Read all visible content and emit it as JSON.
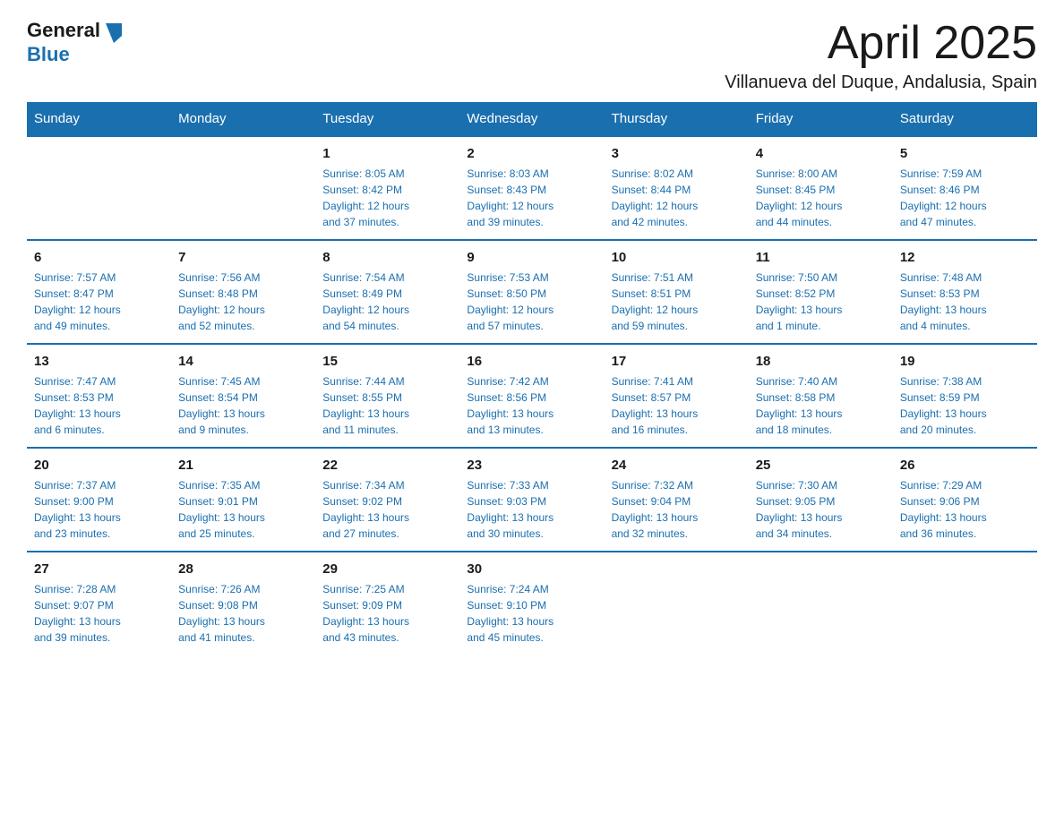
{
  "header": {
    "logo": {
      "general": "General",
      "blue": "Blue",
      "arrow_color": "#1a6faf"
    },
    "title": "April 2025",
    "subtitle": "Villanueva del Duque, Andalusia, Spain"
  },
  "calendar": {
    "days_of_week": [
      "Sunday",
      "Monday",
      "Tuesday",
      "Wednesday",
      "Thursday",
      "Friday",
      "Saturday"
    ],
    "weeks": [
      [
        {
          "day": "",
          "info": ""
        },
        {
          "day": "",
          "info": ""
        },
        {
          "day": "1",
          "info": "Sunrise: 8:05 AM\nSunset: 8:42 PM\nDaylight: 12 hours\nand 37 minutes."
        },
        {
          "day": "2",
          "info": "Sunrise: 8:03 AM\nSunset: 8:43 PM\nDaylight: 12 hours\nand 39 minutes."
        },
        {
          "day": "3",
          "info": "Sunrise: 8:02 AM\nSunset: 8:44 PM\nDaylight: 12 hours\nand 42 minutes."
        },
        {
          "day": "4",
          "info": "Sunrise: 8:00 AM\nSunset: 8:45 PM\nDaylight: 12 hours\nand 44 minutes."
        },
        {
          "day": "5",
          "info": "Sunrise: 7:59 AM\nSunset: 8:46 PM\nDaylight: 12 hours\nand 47 minutes."
        }
      ],
      [
        {
          "day": "6",
          "info": "Sunrise: 7:57 AM\nSunset: 8:47 PM\nDaylight: 12 hours\nand 49 minutes."
        },
        {
          "day": "7",
          "info": "Sunrise: 7:56 AM\nSunset: 8:48 PM\nDaylight: 12 hours\nand 52 minutes."
        },
        {
          "day": "8",
          "info": "Sunrise: 7:54 AM\nSunset: 8:49 PM\nDaylight: 12 hours\nand 54 minutes."
        },
        {
          "day": "9",
          "info": "Sunrise: 7:53 AM\nSunset: 8:50 PM\nDaylight: 12 hours\nand 57 minutes."
        },
        {
          "day": "10",
          "info": "Sunrise: 7:51 AM\nSunset: 8:51 PM\nDaylight: 12 hours\nand 59 minutes."
        },
        {
          "day": "11",
          "info": "Sunrise: 7:50 AM\nSunset: 8:52 PM\nDaylight: 13 hours\nand 1 minute."
        },
        {
          "day": "12",
          "info": "Sunrise: 7:48 AM\nSunset: 8:53 PM\nDaylight: 13 hours\nand 4 minutes."
        }
      ],
      [
        {
          "day": "13",
          "info": "Sunrise: 7:47 AM\nSunset: 8:53 PM\nDaylight: 13 hours\nand 6 minutes."
        },
        {
          "day": "14",
          "info": "Sunrise: 7:45 AM\nSunset: 8:54 PM\nDaylight: 13 hours\nand 9 minutes."
        },
        {
          "day": "15",
          "info": "Sunrise: 7:44 AM\nSunset: 8:55 PM\nDaylight: 13 hours\nand 11 minutes."
        },
        {
          "day": "16",
          "info": "Sunrise: 7:42 AM\nSunset: 8:56 PM\nDaylight: 13 hours\nand 13 minutes."
        },
        {
          "day": "17",
          "info": "Sunrise: 7:41 AM\nSunset: 8:57 PM\nDaylight: 13 hours\nand 16 minutes."
        },
        {
          "day": "18",
          "info": "Sunrise: 7:40 AM\nSunset: 8:58 PM\nDaylight: 13 hours\nand 18 minutes."
        },
        {
          "day": "19",
          "info": "Sunrise: 7:38 AM\nSunset: 8:59 PM\nDaylight: 13 hours\nand 20 minutes."
        }
      ],
      [
        {
          "day": "20",
          "info": "Sunrise: 7:37 AM\nSunset: 9:00 PM\nDaylight: 13 hours\nand 23 minutes."
        },
        {
          "day": "21",
          "info": "Sunrise: 7:35 AM\nSunset: 9:01 PM\nDaylight: 13 hours\nand 25 minutes."
        },
        {
          "day": "22",
          "info": "Sunrise: 7:34 AM\nSunset: 9:02 PM\nDaylight: 13 hours\nand 27 minutes."
        },
        {
          "day": "23",
          "info": "Sunrise: 7:33 AM\nSunset: 9:03 PM\nDaylight: 13 hours\nand 30 minutes."
        },
        {
          "day": "24",
          "info": "Sunrise: 7:32 AM\nSunset: 9:04 PM\nDaylight: 13 hours\nand 32 minutes."
        },
        {
          "day": "25",
          "info": "Sunrise: 7:30 AM\nSunset: 9:05 PM\nDaylight: 13 hours\nand 34 minutes."
        },
        {
          "day": "26",
          "info": "Sunrise: 7:29 AM\nSunset: 9:06 PM\nDaylight: 13 hours\nand 36 minutes."
        }
      ],
      [
        {
          "day": "27",
          "info": "Sunrise: 7:28 AM\nSunset: 9:07 PM\nDaylight: 13 hours\nand 39 minutes."
        },
        {
          "day": "28",
          "info": "Sunrise: 7:26 AM\nSunset: 9:08 PM\nDaylight: 13 hours\nand 41 minutes."
        },
        {
          "day": "29",
          "info": "Sunrise: 7:25 AM\nSunset: 9:09 PM\nDaylight: 13 hours\nand 43 minutes."
        },
        {
          "day": "30",
          "info": "Sunrise: 7:24 AM\nSunset: 9:10 PM\nDaylight: 13 hours\nand 45 minutes."
        },
        {
          "day": "",
          "info": ""
        },
        {
          "day": "",
          "info": ""
        },
        {
          "day": "",
          "info": ""
        }
      ]
    ]
  }
}
